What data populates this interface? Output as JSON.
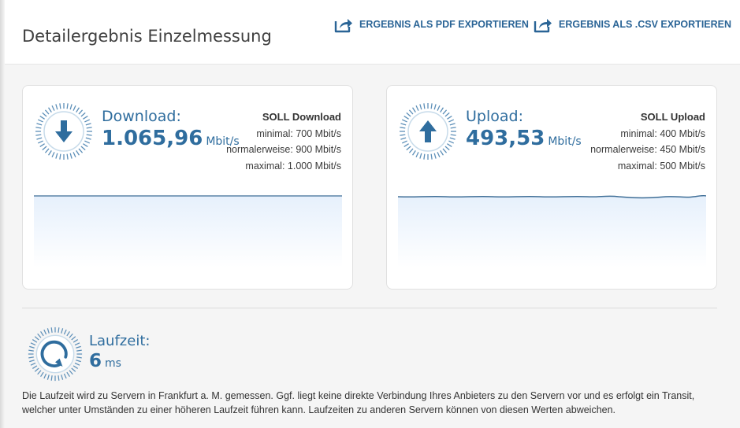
{
  "header": {
    "title": "Detailergebnis Einzelmessung",
    "export_pdf_label": "ERGEBNIS ALS PDF EXPORTIEREN",
    "export_csv_label": "ERGEBNIS ALS .CSV EXPORTIEREN",
    "export_icon": "share-export-icon"
  },
  "colors": {
    "accent": "#2f6d9e",
    "link": "#2a6496",
    "chart_fill": "#e8f2fd",
    "chart_line": "#3d6d96"
  },
  "download": {
    "label": "Download:",
    "value": "1.065,96",
    "unit": "Mbit/s",
    "icon": "arrow-down-icon",
    "soll_title": "SOLL Download",
    "soll_min": "minimal: 700 Mbit/s",
    "soll_normal": "normalerweise: 900 Mbit/s",
    "soll_max": "maximal: 1.000 Mbit/s"
  },
  "upload": {
    "label": "Upload:",
    "value": "493,53",
    "unit": "Mbit/s",
    "icon": "arrow-up-icon",
    "soll_title": "SOLL Upload",
    "soll_min": "minimal: 400 Mbit/s",
    "soll_normal": "normalerweise: 450 Mbit/s",
    "soll_max": "maximal: 500 Mbit/s"
  },
  "latency": {
    "label": "Laufzeit:",
    "value": "6",
    "unit": "ms",
    "icon": "refresh-icon",
    "description": "Die Laufzeit wird zu Servern in Frankfurt a. M. gemessen. Ggf. liegt keine direkte Verbindung Ihres Anbieters zu den Servern vor und es erfolgt ein Transit, welcher unter Umständen zu einer höheren Laufzeit führen kann. Laufzeiten zu anderen Servern können von diesen Werten abweichen."
  }
}
